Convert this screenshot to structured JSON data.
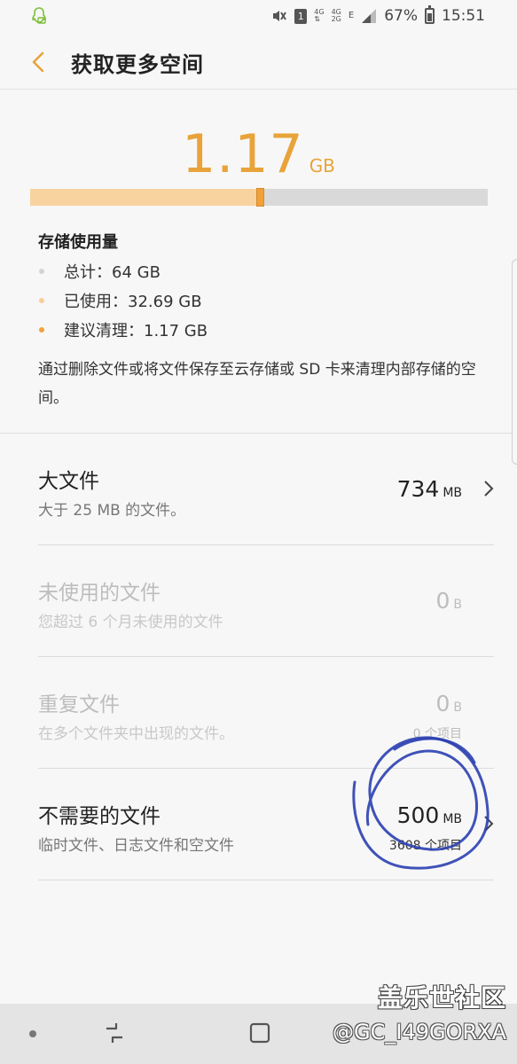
{
  "status_bar": {
    "battery": "67%",
    "time": "15:51",
    "sim_slot": "1",
    "net_a": "4G",
    "net_b_top": "4G",
    "net_b_bottom": "2G",
    "signal_letter": "E",
    "icons": [
      "assistant-icon",
      "mute-icon",
      "sim-icon",
      "signal-icon",
      "battery-icon"
    ]
  },
  "app_bar": {
    "title": "获取更多空间"
  },
  "summary": {
    "value": "1.17",
    "unit": "GB",
    "heading": "存储使用量",
    "bar": {
      "total_gb": 64,
      "used_gb": 32.69,
      "suggested_gb": 1.17
    },
    "legend": [
      {
        "label": "总计：64 GB",
        "color": "#d3d3d3"
      },
      {
        "label": "已使用：32.69 GB",
        "color": "#f8cf98"
      },
      {
        "label": "建议清理：1.17 GB",
        "color": "#f2a13a"
      }
    ],
    "hint": "通过删除文件或将文件保存至云存储或 SD 卡来清理内部存储的空间。"
  },
  "rows": [
    {
      "title": "大文件",
      "desc": "大于 25 MB 的文件。",
      "size": "734",
      "unit": "MB",
      "items": "",
      "enabled": true
    },
    {
      "title": "未使用的文件",
      "desc": "您超过 6 个月未使用的文件",
      "size": "0",
      "unit": "B",
      "items": "",
      "enabled": false
    },
    {
      "title": "重复文件",
      "desc": "在多个文件夹中出现的文件。",
      "size": "0",
      "unit": "B",
      "items": "0 个项目",
      "enabled": false
    },
    {
      "title": "不需要的文件",
      "desc": "临时文件、日志文件和空文件",
      "size": "500",
      "unit": "MB",
      "items": "3608 个项目",
      "enabled": true
    }
  ],
  "watermark": {
    "brand": "盖乐世社区",
    "user": "@GC_I49GORXA"
  },
  "colors": {
    "accent": "#e8a33a",
    "bar_used": "#f8d3a0",
    "bar_suggest": "#f2a13a",
    "annotation": "#2a3fb0"
  }
}
